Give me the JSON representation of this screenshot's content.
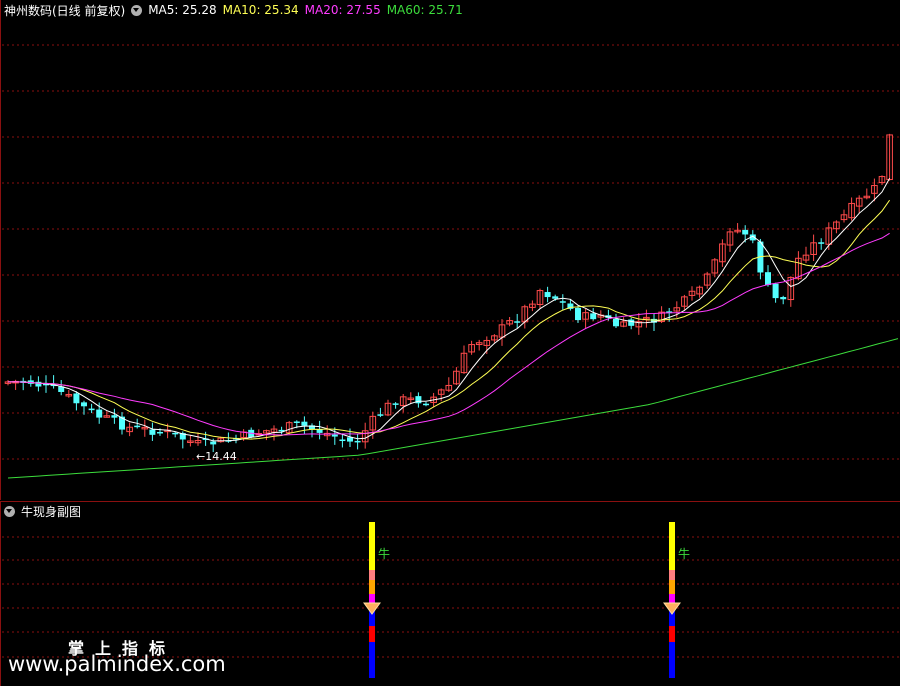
{
  "main_header": {
    "title": "神州数码(日线 前复权)",
    "ma5": "MA5: 25.28",
    "ma10": "MA10: 25.34",
    "ma20": "MA20: 27.55",
    "ma60": "MA60: 25.71"
  },
  "sub_header": {
    "title": "牛现身副图"
  },
  "low_marker": "←14.44",
  "signal_label": "牛",
  "watermark": {
    "line1": "掌上指标",
    "line2": "www.palmindex.com"
  },
  "colors": {
    "up": "#ff4b4b",
    "down": "#54ffff",
    "ma5": "#ffffff",
    "ma10": "#ffff55",
    "ma20": "#ff3cff",
    "ma60": "#3cdc3c",
    "grid": "#8a1010"
  },
  "chart_data": {
    "type": "candlestick",
    "series": [
      {
        "name": "MA5",
        "value": 25.28
      },
      {
        "name": "MA10",
        "value": 25.34
      },
      {
        "name": "MA20",
        "value": 27.55
      },
      {
        "name": "MA60",
        "value": 25.71
      }
    ],
    "annotations": [
      "←14.44"
    ],
    "indicator": {
      "title": "牛现身副图",
      "signals": [
        {
          "label": "牛",
          "colors": [
            "#ffff00",
            "#ff7f7f",
            "#ffa500",
            "#ff00ff",
            "#0000ff",
            "#ff0000"
          ]
        },
        {
          "label": "牛",
          "colors": [
            "#ffff00",
            "#ff7f7f",
            "#ffa500",
            "#ff00ff",
            "#0000ff",
            "#ff0000"
          ]
        }
      ]
    }
  }
}
